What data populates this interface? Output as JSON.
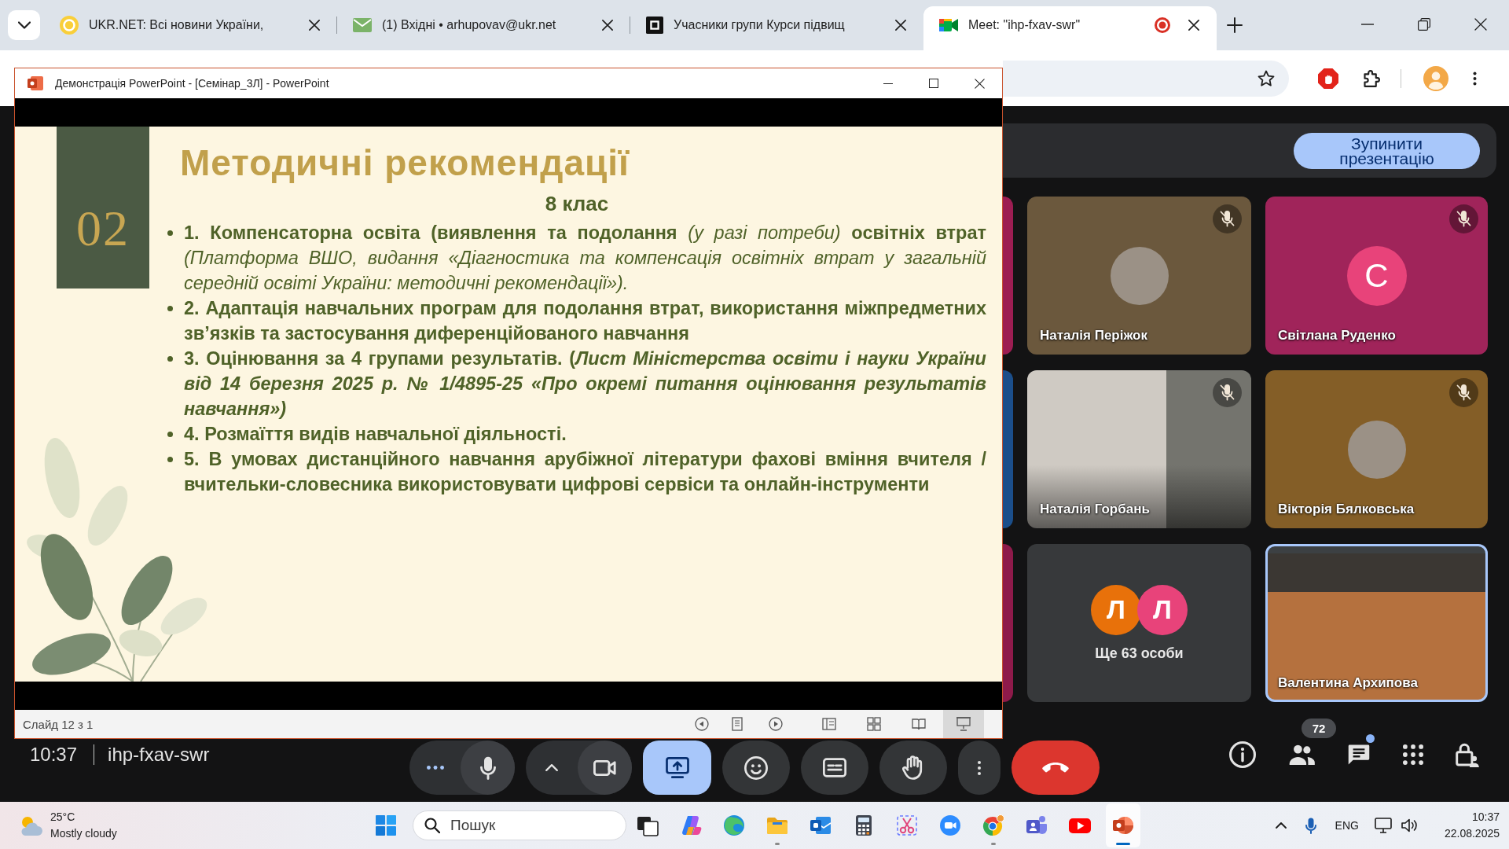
{
  "browser": {
    "tabs": [
      {
        "title": "UKR.NET: Всі новини України,",
        "selected": false,
        "recording": false
      },
      {
        "title": "(1) Вхідні • arhupovav@ukr.net",
        "selected": false,
        "recording": false
      },
      {
        "title": "Учасники групи Курси підвищ",
        "selected": false,
        "recording": false
      },
      {
        "title": "Meet: \"ihp-fxav-swr\"",
        "selected": true,
        "recording": true
      }
    ]
  },
  "powerpoint": {
    "title": "Демонстрація PowerPoint - [Семінар_3Л] - PowerPoint",
    "slide": {
      "number": "02",
      "title": "Методичні рекомендації",
      "subtitle": "8 клас",
      "bullets": [
        "**1. Компенсаторна освіта (виявлення та подолання** *(у разі потреби)* **освітніх втрат** *(Платформа ВШО, видання «Діагностика та компенсація освітніх втрат у загальній середній освіті України: методичні рекомендації»).*",
        "2. Адаптація навчальних програм для подолання втрат, використання міжпредметних зв’язків та застосування диференційованого навчання",
        "3. Оцінювання за 4 групами результатів. (*Лист Міністерства освіти і науки України від 14 березня 2025 р. № 1/4895-25 «Про окремі питання оцінювання результатів навчання»)*",
        "4. Розмаїття видів навчальної діяльності.",
        "5. В умовах дистанційного навчання арубіжної літератури фахові вміння вчителя / вчительки-словесника використовувати цифрові сервіси та онлайн-інструменти"
      ]
    },
    "status": "Слайд 12 з 1"
  },
  "meet": {
    "stop_button": "Зупинити презентацію",
    "partial_tiles": [
      {
        "color": "#9c1d52"
      },
      {
        "color": "#1b4e8a"
      },
      {
        "color": "#8e1a4a"
      }
    ],
    "tiles": [
      {
        "kind": "avatar-photo",
        "name": "Наталія Періжок",
        "color": "#6b583d",
        "muted": true,
        "speaking": false
      },
      {
        "kind": "avatar-letter",
        "name": "Світлана Руденко",
        "color": "#a0245a",
        "avatar": {
          "letter": "С",
          "color": "#e8437a"
        },
        "muted": true,
        "speaking": false
      },
      {
        "kind": "video",
        "name": "Наталія Горбань",
        "muted": true,
        "speaking": false
      },
      {
        "kind": "avatar-photo",
        "name": "Вікторія Бялковська",
        "color": "#845e27",
        "muted": true,
        "speaking": false
      },
      {
        "kind": "others",
        "label": "Ще 63 особи",
        "avatars": [
          {
            "letter": "Л",
            "color": "#e8710a"
          },
          {
            "letter": "Л",
            "color": "#e8437a"
          }
        ],
        "muted": false,
        "speaking": false
      },
      {
        "kind": "video",
        "name": "Валентина Архипова",
        "muted": false,
        "speaking": true
      }
    ],
    "clock": "10:37",
    "meeting_code": "ihp-fxav-swr",
    "mic_muted": false,
    "camera_off": false,
    "presenting": true,
    "people_count": "72",
    "chat_unread": true
  },
  "taskbar": {
    "weather": {
      "temperature": "25°C",
      "condition": "Mostly cloudy"
    },
    "search": {
      "placeholder": "Пошук"
    },
    "apps": [
      {
        "kind": "task-view",
        "running": false,
        "selected": false
      },
      {
        "kind": "copilot",
        "running": false,
        "selected": false
      },
      {
        "kind": "edge",
        "running": false,
        "selected": false
      },
      {
        "kind": "files",
        "running": true,
        "selected": false
      },
      {
        "kind": "mail",
        "running": false,
        "selected": false
      },
      {
        "kind": "calculator",
        "running": false,
        "selected": false
      },
      {
        "kind": "snipping",
        "running": false,
        "selected": false
      },
      {
        "kind": "zoom",
        "running": false,
        "selected": false
      },
      {
        "kind": "chrome",
        "running": true,
        "selected": false
      },
      {
        "kind": "teams",
        "running": false,
        "selected": false
      },
      {
        "kind": "youtube",
        "running": false,
        "selected": false
      },
      {
        "kind": "powerpoint",
        "running": true,
        "selected": true
      }
    ],
    "language": "ENG",
    "time": "10:37",
    "date": "22.08.2025"
  }
}
